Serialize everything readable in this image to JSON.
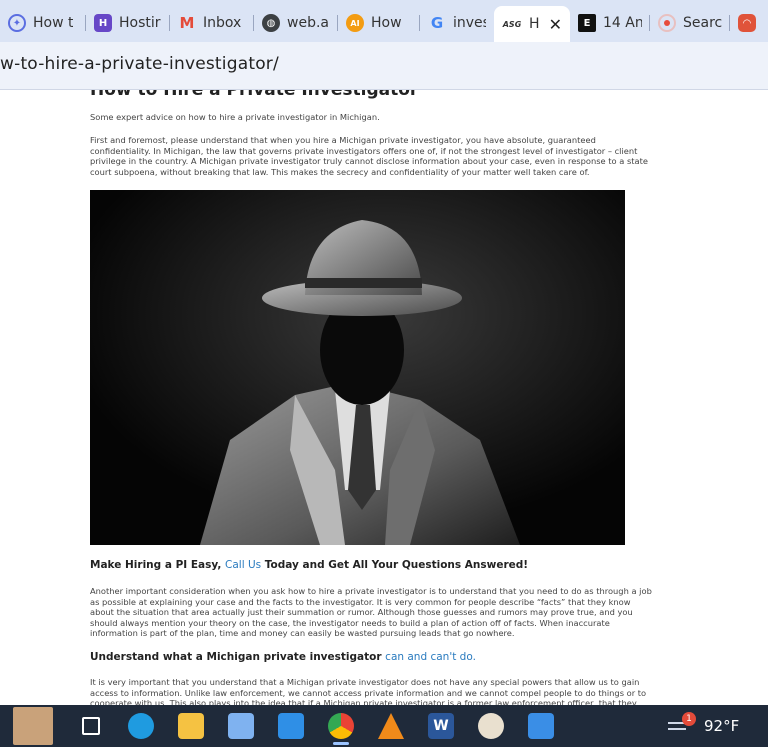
{
  "browser": {
    "tabs": [
      {
        "label": "How t",
        "icon": "copilot-icon",
        "color": "#5b6ee1"
      },
      {
        "label": "Hostir",
        "icon": "hostinger-icon",
        "color": "#6747c7"
      },
      {
        "label": "Inbox",
        "icon": "gmail-icon",
        "color": "#e44b3a"
      },
      {
        "label": "web.a",
        "icon": "globe-icon",
        "color": "#3c4043"
      },
      {
        "label": "How",
        "icon": "ai-icon",
        "color": "#f39c12"
      },
      {
        "label": "invest",
        "icon": "google-icon",
        "color": "#4285f4"
      },
      {
        "label": "H",
        "icon": "asg-icon",
        "color": "#111111",
        "active": true
      },
      {
        "label": "14 An",
        "icon": "esquire-icon",
        "color": "#111111"
      },
      {
        "label": "Searc",
        "icon": "record-icon",
        "color": "#e74c3c"
      },
      {
        "label": "",
        "icon": "app-icon",
        "color": "#e0533a"
      }
    ],
    "asg_badge": "ASG",
    "url": "w-to-hire-a-private-investigator/"
  },
  "article": {
    "title_cut": "How to Hire a Private Investigator",
    "intro": "Some expert advice on how to hire a private investigator in Michigan.",
    "para1": "First and foremost, please understand that when you hire a Michigan private investigator, you have absolute, guaranteed confidentiality. In Michigan, the law that governs private investigators offers one of, if not the strongest level of investigator – client privilege in the country. A Michigan private investigator truly cannot disclose information about your case, even in response to a state court subpoena, without breaking that law. This makes the secrecy and confidentiality of your matter well taken care of.",
    "cta_pre": "Make Hiring a PI Easy,",
    "cta_link": "Call Us",
    "cta_post": "Today and Get All Your Questions Answered!",
    "para2": "Another important consideration when you ask how to hire a private investigator is to understand that you need to do as through a job as possible at explaining your case and the facts to the investigator. It is very common for people describe “facts” that they know about the situation that area actually just their summation or rumor. Although those guesses and rumors may prove true, and you should always mention your theory on the case, the investigator needs to build a plan of action off of facts. When inaccurate information is part of the plan, time and money can easily be wasted pursuing leads that go nowhere.",
    "h2_pre": "Understand what a Michigan private investigator",
    "h2_link": "can and can't do.",
    "para3": "It is very important that you understand that a Michigan private investigator does not have any special powers that allow us to gain access to information. Unlike law enforcement, we cannot access private information and we cannot compel people to do things or to cooperate with us. This also plays into the idea that if a Michigan private investigator is a former law enforcement officer, that they can use friends within law enforcement to give them private"
  },
  "taskbar": {
    "items": [
      {
        "name": "avatar",
        "color": "#c9a27a"
      },
      {
        "name": "task-view-icon",
        "color": "#ffffff"
      },
      {
        "name": "edge-icon",
        "color": "#1f9be0"
      },
      {
        "name": "file-explorer-icon",
        "color": "#f5c242"
      },
      {
        "name": "store-icon",
        "color": "#7fb2f0"
      },
      {
        "name": "mail-icon",
        "color": "#2f8fe6"
      },
      {
        "name": "chrome-icon",
        "color": "#34a853",
        "active": true
      },
      {
        "name": "vlc-icon",
        "color": "#f08a1a"
      },
      {
        "name": "word-icon",
        "color": "#2b579a"
      },
      {
        "name": "paint-icon",
        "color": "#e9e0cf"
      },
      {
        "name": "photos-icon",
        "color": "#3a8ee6"
      }
    ],
    "weather_badge": "1",
    "temperature": "92°F"
  }
}
